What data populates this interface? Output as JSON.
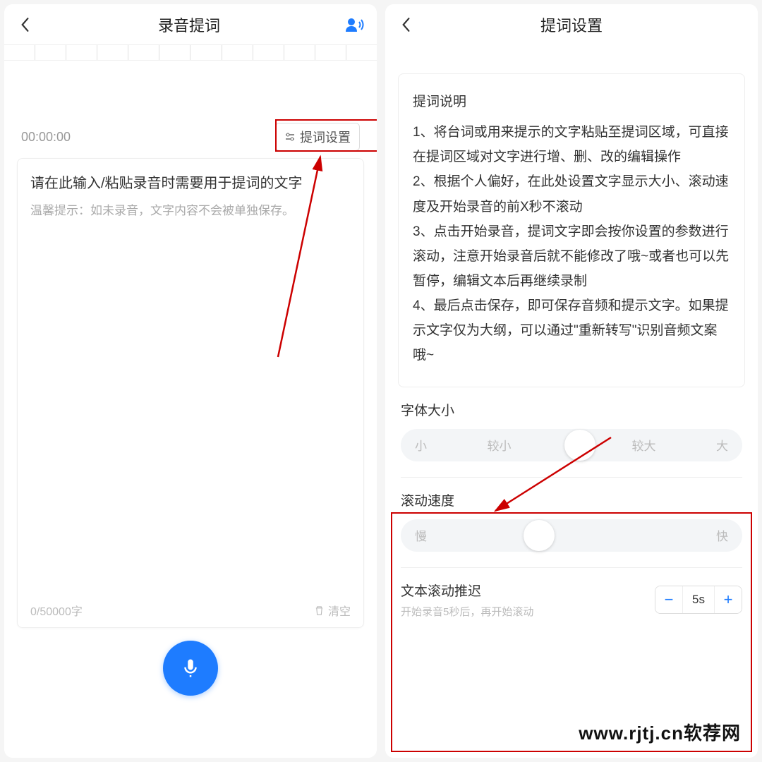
{
  "left": {
    "title": "录音提词",
    "timer": "00:00:00",
    "settings_label": "提词设置",
    "placeholder_main": "请在此输入/粘贴录音时需要用于提词的文字",
    "placeholder_tip": "温馨提示：如未录音，文字内容不会被单独保存。",
    "counter": "0/50000字",
    "clear_label": "清空"
  },
  "right": {
    "title": "提词设置",
    "info_title": "提词说明",
    "info_lines": [
      "1、将台词或用来提示的文字粘贴至提词区域，可直接在提词区域对文字进行增、删、改的编辑操作",
      "2、根据个人偏好，在此处设置文字显示大小、滚动速度及开始录音的前X秒不滚动",
      "3、点击开始录音，提词文字即会按你设置的参数进行滚动，注意开始录音后就不能修改了哦~或者也可以先暂停，编辑文本后再继续录制",
      "4、最后点击保存，即可保存音频和提示文字。如果提示文字仅为大纲，可以通过\"重新转写\"识别音频文案哦~"
    ],
    "font_size": {
      "label": "字体大小",
      "options": [
        "小",
        "较小",
        "较大",
        "大"
      ]
    },
    "scroll_speed": {
      "label": "滚动速度",
      "min_label": "慢",
      "max_label": "快"
    },
    "delay": {
      "label": "文本滚动推迟",
      "sub": "开始录音5秒后，再开始滚动",
      "value": "5s"
    }
  },
  "watermark": "www.rjtj.cn软荐网",
  "colors": {
    "accent": "#1e7cff",
    "annotation": "#c00000"
  }
}
